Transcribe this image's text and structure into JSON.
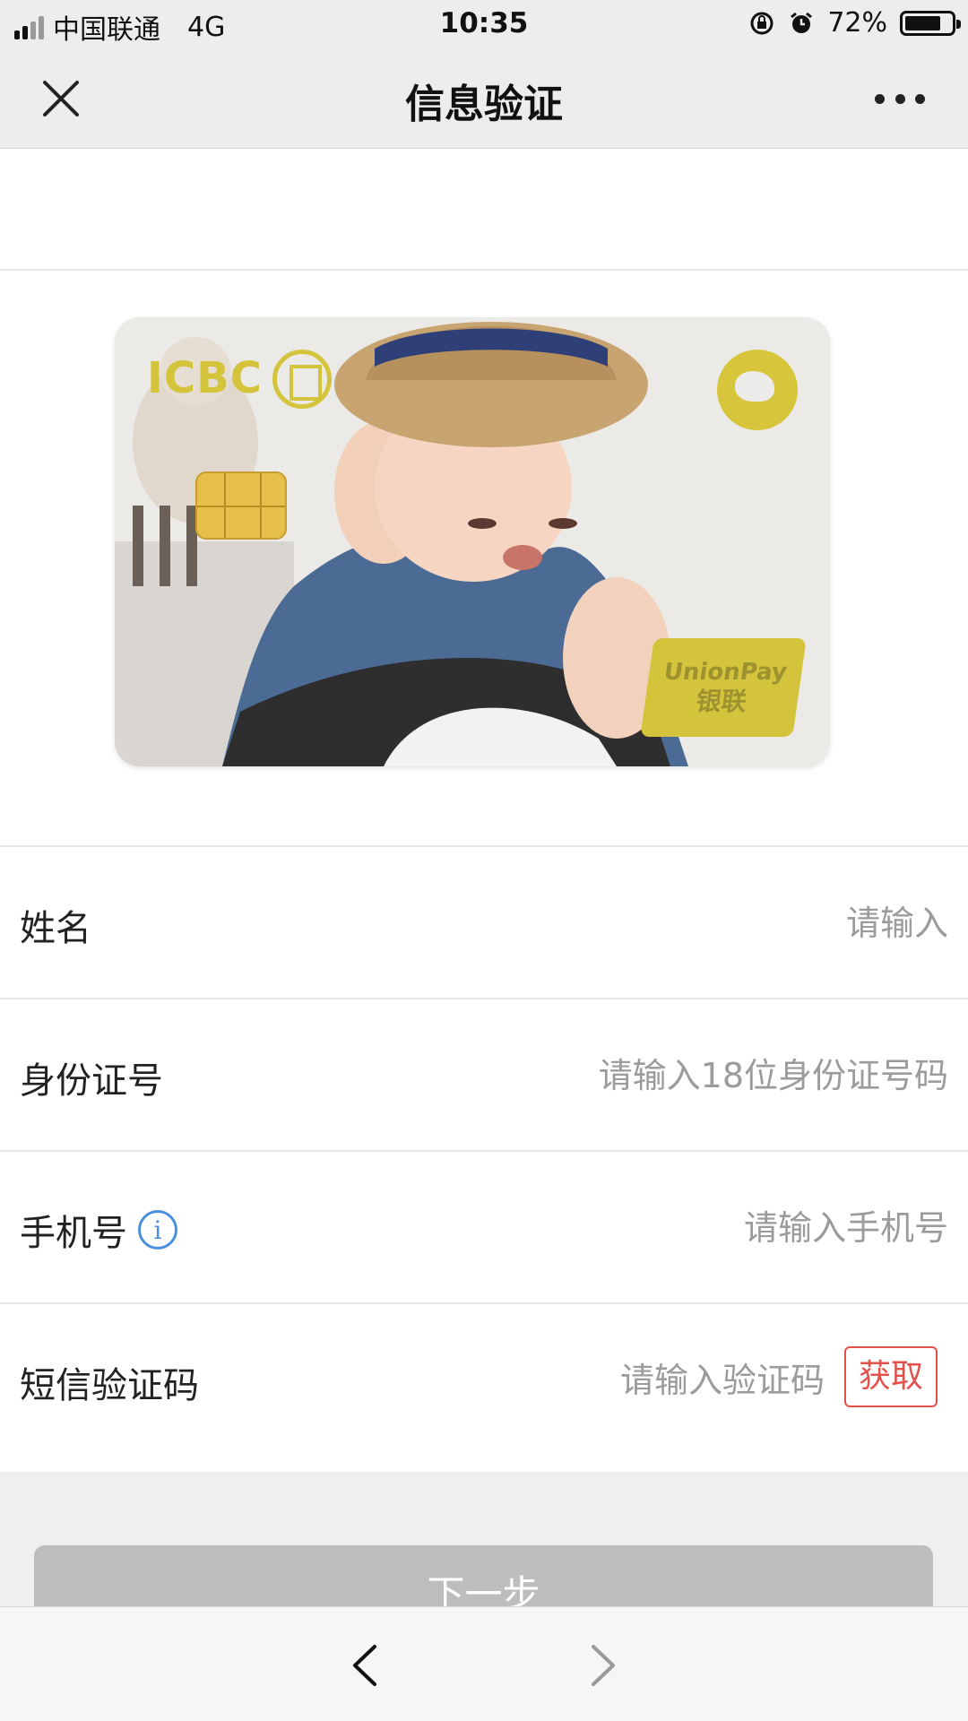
{
  "status_bar": {
    "carrier": "中国联通",
    "network": "4G",
    "time": "10:35",
    "battery_percent": "72%",
    "battery_level": 0.72,
    "signal_bars": 2
  },
  "header": {
    "title": "信息验证",
    "close_icon": "close-icon",
    "more_icon": "more-dots-icon"
  },
  "card": {
    "bank_name": "ICBC",
    "network_line1": "UnionPay",
    "network_line2": "银联",
    "colors": {
      "logo": "#d4c43c",
      "chip": "#e6c04a"
    }
  },
  "form": {
    "rows": [
      {
        "label": "姓名",
        "placeholder": "请输入"
      },
      {
        "label": "身份证号",
        "placeholder": "请输入18位身份证号码"
      },
      {
        "label": "手机号",
        "placeholder": "请输入手机号",
        "info_icon": "info-icon"
      },
      {
        "label": "短信验证码",
        "placeholder": "请输入验证码",
        "action_label": "获取"
      }
    ],
    "info_symbol": "i"
  },
  "actions": {
    "next_label": "下一步"
  },
  "browser_bar": {
    "back_icon": "chevron-left-icon",
    "forward_icon": "chevron-right-icon"
  },
  "colors": {
    "header_bg": "#ededed",
    "accent_red": "#e4504a",
    "info_blue": "#4a8fe0",
    "disabled_button": "#bdbdbd"
  }
}
